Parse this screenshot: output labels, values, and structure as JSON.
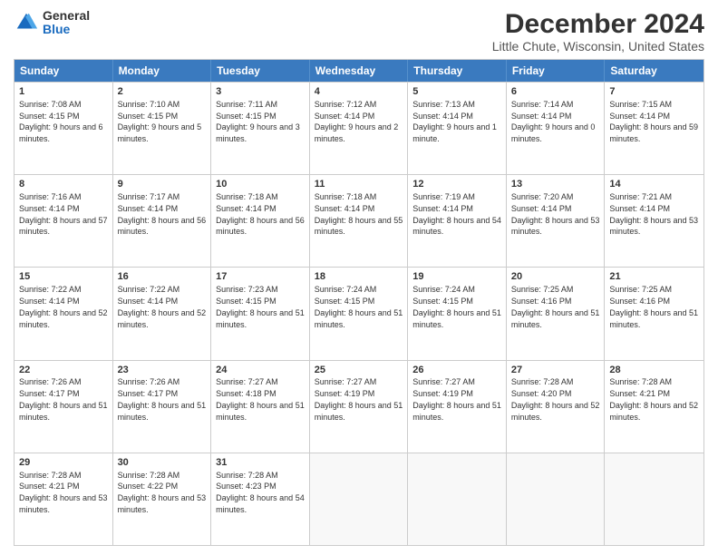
{
  "header": {
    "logo_general": "General",
    "logo_blue": "Blue",
    "main_title": "December 2024",
    "sub_title": "Little Chute, Wisconsin, United States"
  },
  "calendar": {
    "days": [
      "Sunday",
      "Monday",
      "Tuesday",
      "Wednesday",
      "Thursday",
      "Friday",
      "Saturday"
    ],
    "weeks": [
      [
        {
          "num": "1",
          "sunrise": "7:08 AM",
          "sunset": "4:15 PM",
          "daylight": "9 hours and 6 minutes."
        },
        {
          "num": "2",
          "sunrise": "7:10 AM",
          "sunset": "4:15 PM",
          "daylight": "9 hours and 5 minutes."
        },
        {
          "num": "3",
          "sunrise": "7:11 AM",
          "sunset": "4:15 PM",
          "daylight": "9 hours and 3 minutes."
        },
        {
          "num": "4",
          "sunrise": "7:12 AM",
          "sunset": "4:14 PM",
          "daylight": "9 hours and 2 minutes."
        },
        {
          "num": "5",
          "sunrise": "7:13 AM",
          "sunset": "4:14 PM",
          "daylight": "9 hours and 1 minute."
        },
        {
          "num": "6",
          "sunrise": "7:14 AM",
          "sunset": "4:14 PM",
          "daylight": "9 hours and 0 minutes."
        },
        {
          "num": "7",
          "sunrise": "7:15 AM",
          "sunset": "4:14 PM",
          "daylight": "8 hours and 59 minutes."
        }
      ],
      [
        {
          "num": "8",
          "sunrise": "7:16 AM",
          "sunset": "4:14 PM",
          "daylight": "8 hours and 57 minutes."
        },
        {
          "num": "9",
          "sunrise": "7:17 AM",
          "sunset": "4:14 PM",
          "daylight": "8 hours and 56 minutes."
        },
        {
          "num": "10",
          "sunrise": "7:18 AM",
          "sunset": "4:14 PM",
          "daylight": "8 hours and 56 minutes."
        },
        {
          "num": "11",
          "sunrise": "7:18 AM",
          "sunset": "4:14 PM",
          "daylight": "8 hours and 55 minutes."
        },
        {
          "num": "12",
          "sunrise": "7:19 AM",
          "sunset": "4:14 PM",
          "daylight": "8 hours and 54 minutes."
        },
        {
          "num": "13",
          "sunrise": "7:20 AM",
          "sunset": "4:14 PM",
          "daylight": "8 hours and 53 minutes."
        },
        {
          "num": "14",
          "sunrise": "7:21 AM",
          "sunset": "4:14 PM",
          "daylight": "8 hours and 53 minutes."
        }
      ],
      [
        {
          "num": "15",
          "sunrise": "7:22 AM",
          "sunset": "4:14 PM",
          "daylight": "8 hours and 52 minutes."
        },
        {
          "num": "16",
          "sunrise": "7:22 AM",
          "sunset": "4:14 PM",
          "daylight": "8 hours and 52 minutes."
        },
        {
          "num": "17",
          "sunrise": "7:23 AM",
          "sunset": "4:15 PM",
          "daylight": "8 hours and 51 minutes."
        },
        {
          "num": "18",
          "sunrise": "7:24 AM",
          "sunset": "4:15 PM",
          "daylight": "8 hours and 51 minutes."
        },
        {
          "num": "19",
          "sunrise": "7:24 AM",
          "sunset": "4:15 PM",
          "daylight": "8 hours and 51 minutes."
        },
        {
          "num": "20",
          "sunrise": "7:25 AM",
          "sunset": "4:16 PM",
          "daylight": "8 hours and 51 minutes."
        },
        {
          "num": "21",
          "sunrise": "7:25 AM",
          "sunset": "4:16 PM",
          "daylight": "8 hours and 51 minutes."
        }
      ],
      [
        {
          "num": "22",
          "sunrise": "7:26 AM",
          "sunset": "4:17 PM",
          "daylight": "8 hours and 51 minutes."
        },
        {
          "num": "23",
          "sunrise": "7:26 AM",
          "sunset": "4:17 PM",
          "daylight": "8 hours and 51 minutes."
        },
        {
          "num": "24",
          "sunrise": "7:27 AM",
          "sunset": "4:18 PM",
          "daylight": "8 hours and 51 minutes."
        },
        {
          "num": "25",
          "sunrise": "7:27 AM",
          "sunset": "4:19 PM",
          "daylight": "8 hours and 51 minutes."
        },
        {
          "num": "26",
          "sunrise": "7:27 AM",
          "sunset": "4:19 PM",
          "daylight": "8 hours and 51 minutes."
        },
        {
          "num": "27",
          "sunrise": "7:28 AM",
          "sunset": "4:20 PM",
          "daylight": "8 hours and 52 minutes."
        },
        {
          "num": "28",
          "sunrise": "7:28 AM",
          "sunset": "4:21 PM",
          "daylight": "8 hours and 52 minutes."
        }
      ],
      [
        {
          "num": "29",
          "sunrise": "7:28 AM",
          "sunset": "4:21 PM",
          "daylight": "8 hours and 53 minutes."
        },
        {
          "num": "30",
          "sunrise": "7:28 AM",
          "sunset": "4:22 PM",
          "daylight": "8 hours and 53 minutes."
        },
        {
          "num": "31",
          "sunrise": "7:28 AM",
          "sunset": "4:23 PM",
          "daylight": "8 hours and 54 minutes."
        },
        null,
        null,
        null,
        null
      ]
    ]
  }
}
